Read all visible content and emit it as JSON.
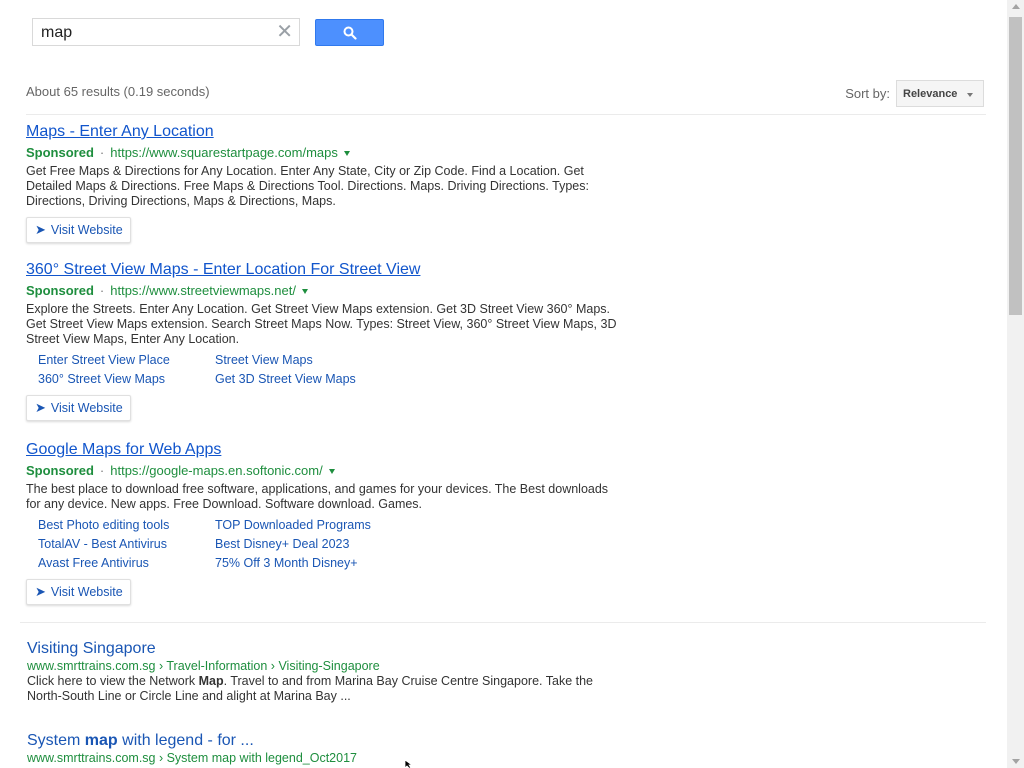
{
  "search": {
    "query": "map",
    "clear_icon": "close-icon",
    "button_icon": "search-icon"
  },
  "stats": {
    "results_text": "About 65 results (0.19 seconds)"
  },
  "sort": {
    "label": "Sort by:",
    "selected": "Relevance"
  },
  "ads": [
    {
      "title": "Maps - Enter Any Location",
      "sponsored": "Sponsored",
      "dot": "·",
      "url": "https://www.squarestartpage.com/maps",
      "description": "Get Free Maps & Directions for Any Location. Enter Any State, City or Zip Code. Find a Location. Get Detailed Maps & Directions. Free Maps & Directions Tool. Directions. Maps. Driving Directions. Types: Directions, Driving Directions, Maps & Directions, Maps.",
      "visit_label": "Visit Website"
    },
    {
      "title": "360° Street View Maps - Enter Location For Street View",
      "sponsored": "Sponsored",
      "dot": "·",
      "url": "https://www.streetviewmaps.net/",
      "description": "Explore the Streets. Enter Any Location. Get Street View Maps extension. Get 3D Street View 360° Maps. Get Street View Maps extension. Search Street Maps Now. Types: Street View, 360° Street View Maps, 3D Street View Maps, Enter Any Location.",
      "sitelinks": [
        "Enter Street View Place",
        "Street View Maps",
        "360° Street View Maps",
        "Get 3D Street View Maps"
      ],
      "visit_label": "Visit Website"
    },
    {
      "title": "Google Maps for Web Apps",
      "sponsored": "Sponsored",
      "dot": "·",
      "url": "https://google-maps.en.softonic.com/",
      "description": "The best place to download free software, applications, and games for your devices. The Best downloads for any device. New apps. Free Download. Software download. Games.",
      "sitelinks": [
        "Best Photo editing tools",
        "TOP Downloaded Programs",
        "TotalAV - Best Antivirus",
        "Best Disney+ Deal 2023",
        "Avast Free Antivirus",
        "75% Off 3 Month Disney+"
      ],
      "visit_label": "Visit Website"
    }
  ],
  "results": [
    {
      "title": "Visiting Singapore",
      "url": "www.smrttrains.com.sg › Travel-Information › Visiting-Singapore",
      "snippet_before": "Click here to view the Network ",
      "snippet_bold": "Map",
      "snippet_after": ". Travel to and from Marina Bay Cruise Centre Singapore. Take the North-South Line or Circle Line and alight at Marina Bay ..."
    },
    {
      "title_before": "System ",
      "title_bold": "map",
      "title_after": " with legend - for ...",
      "url": "www.smrttrains.com.sg › System map with legend_Oct2017"
    }
  ],
  "colors": {
    "link": "#1a56b4",
    "url_green": "#1e8e3e",
    "button_blue": "#4d90fe"
  }
}
